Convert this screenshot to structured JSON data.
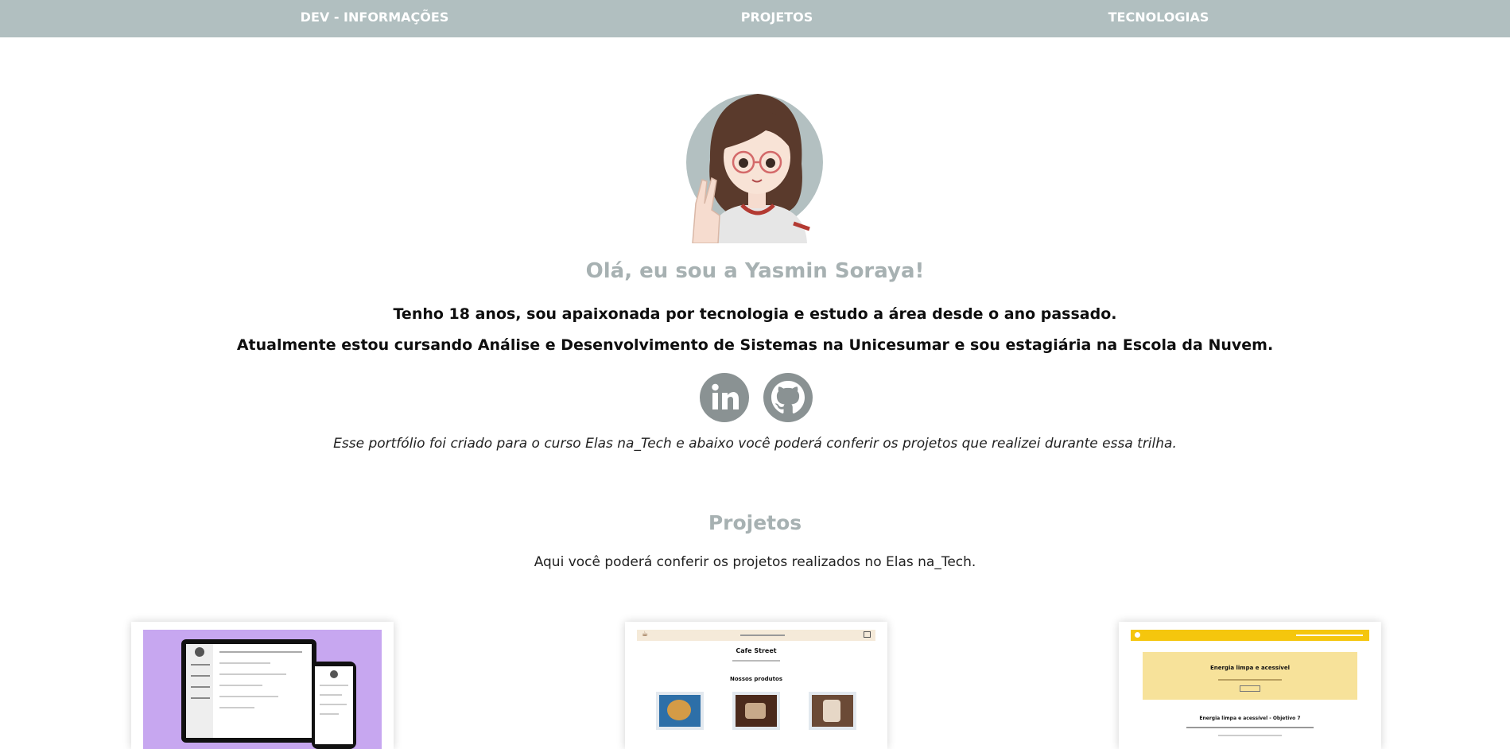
{
  "nav": {
    "items": [
      {
        "label": "DEV - INFORMAÇÕES"
      },
      {
        "label": "PROJETOS"
      },
      {
        "label": "TECNOLOGIAS"
      }
    ]
  },
  "hero": {
    "avatar_alt": "avatar",
    "greeting": "Olá, eu sou a Yasmin Soraya!",
    "bio_line_1": "Tenho 18 anos, sou apaixonada por tecnologia e estudo a área desde o ano passado.",
    "bio_line_2": "Atualmente estou cursando Análise e Desenvolvimento de Sistemas na Unicesumar e sou estagiária na Escola da Nuvem.",
    "social": [
      {
        "name": "linkedin-icon"
      },
      {
        "name": "github-icon"
      }
    ],
    "note": "Esse portfólio foi criado para o curso Elas na_Tech e abaixo você poderá conferir os projetos que realizei durante essa trilha."
  },
  "projects": {
    "title": "Projetos",
    "subtitle": "Aqui você poderá conferir os projetos realizados no Elas na_Tech.",
    "cards": [
      {
        "preview": "responsive-mockup"
      },
      {
        "preview": "cafe-site",
        "site_title": "Cafe Street",
        "section_label": "Nossos produtos"
      },
      {
        "preview": "energy-site",
        "hero_title": "Energia limpa e acessível",
        "section_heading": "Energia limpa e acessível - Objetivo 7"
      }
    ]
  },
  "colors": {
    "nav_bg": "#b1bfc0",
    "accent_gray": "#a7b1b2",
    "purple": "#c7a7f0",
    "yellow": "#f5c60d"
  }
}
